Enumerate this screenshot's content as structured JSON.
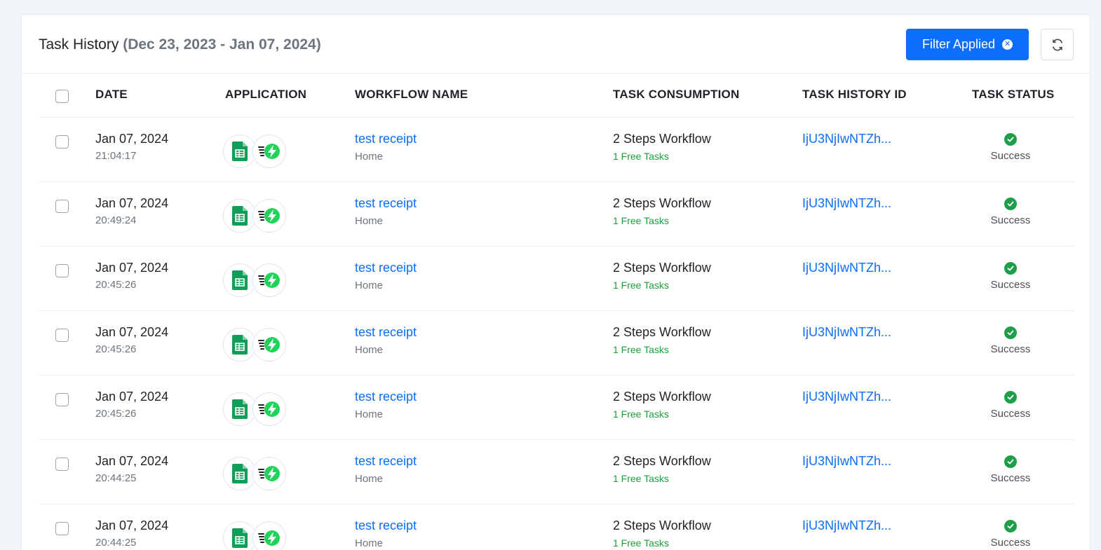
{
  "header": {
    "title": "Task History",
    "date_range": "(Dec 23, 2023 - Jan 07, 2024)",
    "filter_label": "Filter Applied",
    "filter_clear_icon": "x-circle-icon",
    "refresh_icon": "refresh-icon"
  },
  "columns": {
    "date": "DATE",
    "application": "APPLICATION",
    "workflow_name": "WORKFLOW NAME",
    "task_consumption": "TASK CONSUMPTION",
    "task_history_id": "TASK HISTORY ID",
    "task_status": "TASK STATUS"
  },
  "colors": {
    "accent": "#0b6efd",
    "success": "#1e9e4a",
    "free_tasks": "#1f9d3a",
    "sheets_green": "#0f9d58",
    "pabbly_green": "#21d35c"
  },
  "rows": [
    {
      "date": "Jan 07, 2024",
      "time": "21:04:17",
      "apps": [
        "google-sheets-icon",
        "pabbly-webhook-icon"
      ],
      "workflow": "test receipt",
      "folder": "Home",
      "consumption": "2 Steps Workflow",
      "free": "1 Free Tasks",
      "history_id": "IjU3NjIwNTZh...",
      "status": "Success"
    },
    {
      "date": "Jan 07, 2024",
      "time": "20:49:24",
      "apps": [
        "google-sheets-icon",
        "pabbly-webhook-icon"
      ],
      "workflow": "test receipt",
      "folder": "Home",
      "consumption": "2 Steps Workflow",
      "free": "1 Free Tasks",
      "history_id": "IjU3NjIwNTZh...",
      "status": "Success"
    },
    {
      "date": "Jan 07, 2024",
      "time": "20:45:26",
      "apps": [
        "google-sheets-icon",
        "pabbly-webhook-icon"
      ],
      "workflow": "test receipt",
      "folder": "Home",
      "consumption": "2 Steps Workflow",
      "free": "1 Free Tasks",
      "history_id": "IjU3NjIwNTZh...",
      "status": "Success"
    },
    {
      "date": "Jan 07, 2024",
      "time": "20:45:26",
      "apps": [
        "google-sheets-icon",
        "pabbly-webhook-icon"
      ],
      "workflow": "test receipt",
      "folder": "Home",
      "consumption": "2 Steps Workflow",
      "free": "1 Free Tasks",
      "history_id": "IjU3NjIwNTZh...",
      "status": "Success"
    },
    {
      "date": "Jan 07, 2024",
      "time": "20:45:26",
      "apps": [
        "google-sheets-icon",
        "pabbly-webhook-icon"
      ],
      "workflow": "test receipt",
      "folder": "Home",
      "consumption": "2 Steps Workflow",
      "free": "1 Free Tasks",
      "history_id": "IjU3NjIwNTZh...",
      "status": "Success"
    },
    {
      "date": "Jan 07, 2024",
      "time": "20:44:25",
      "apps": [
        "google-sheets-icon",
        "pabbly-webhook-icon"
      ],
      "workflow": "test receipt",
      "folder": "Home",
      "consumption": "2 Steps Workflow",
      "free": "1 Free Tasks",
      "history_id": "IjU3NjIwNTZh...",
      "status": "Success"
    },
    {
      "date": "Jan 07, 2024",
      "time": "20:44:25",
      "apps": [
        "google-sheets-icon",
        "pabbly-webhook-icon"
      ],
      "workflow": "test receipt",
      "folder": "Home",
      "consumption": "2 Steps Workflow",
      "free": "1 Free Tasks",
      "history_id": "IjU3NjIwNTZh...",
      "status": "Success"
    }
  ]
}
